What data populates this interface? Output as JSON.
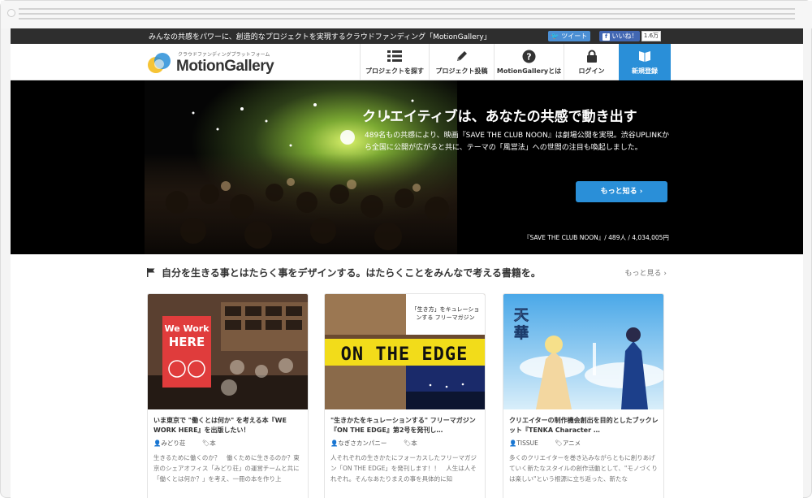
{
  "topbar": {
    "tagline": "みんなの共感をパワーに、創造的なプロジェクトを実現するクラウドファンディング「MotionGallery」",
    "tweet_label": "ツイート",
    "like_label": "いいね！",
    "like_count": "1.6万"
  },
  "header": {
    "logo_sub": "クラウドファンディングプラットフォーム",
    "logo_text": "MotionGallery",
    "nav": [
      {
        "label": "プロジェクトを探す",
        "icon": "list-icon"
      },
      {
        "label": "プロジェクト投稿",
        "icon": "pencil-icon"
      },
      {
        "label": "MotionGalleryとは",
        "icon": "question-icon"
      },
      {
        "label": "ログイン",
        "icon": "lock-icon"
      },
      {
        "label": "新規登録",
        "icon": "book-icon"
      }
    ]
  },
  "hero": {
    "title": "クリエイティブは、あなたの共感で動き出す",
    "description": "489名もの共感により、映画『SAVE THE CLUB NOON』は劇場公開を実現。渋谷UPLINKから全国に公開が広がると共に、テーマの「風営法」への世間の注目も喚起しました。",
    "more_label": "もっと知る ›",
    "caption": "『SAVE THE CLUB NOON』/ 489人 / 4,034,005円"
  },
  "section": {
    "title": "自分を生きる事とはたらく事をデザインする。はたらくことをみんなで考える書籍を。",
    "more_label": "もっと見る ›"
  },
  "cards": [
    {
      "title": "いま東京で \"働くとは何か\" を考える本『WE WORK HERE』を出版したい！",
      "author": "みどり荘",
      "tag": "本",
      "text": "生きるために働くのか？　働くために生きるのか？東京のシェアオフィス「みどり荘」の運営チームと共に「働くとは何か？」を考え、一冊の本を作り上",
      "image_text": "We Work HERE"
    },
    {
      "title": "\"生きかたをキュレーションする\" フリーマガジン『ON THE EDGE』第2号を発刊し…",
      "author": "なぎさカンパニー",
      "tag": "本",
      "text": "人それぞれの生きかたにフォーカスしたフリーマガジン「ON THE EDGE」を発刊します！！　人生は人それぞれ。そんなあたりまえの事を具体的に知",
      "image_text": "ON THE EDGE",
      "image_sub": "「生き方」をキュレーションする フリーマガジン"
    },
    {
      "title": "クリエイターの制作機会創出を目的としたブックレット『TENKA Character …",
      "author": "TISSUE",
      "tag": "アニメ",
      "text": "多くのクリエイターを巻き込みながらともに創りあげていく新たなスタイルの創作活動として、\"モノづくりは楽しい\"という根源に立ち返った、新たな",
      "image_text": "天華"
    }
  ],
  "colors": {
    "accent": "#2a8fd8",
    "topbar": "#2e2e2e"
  }
}
